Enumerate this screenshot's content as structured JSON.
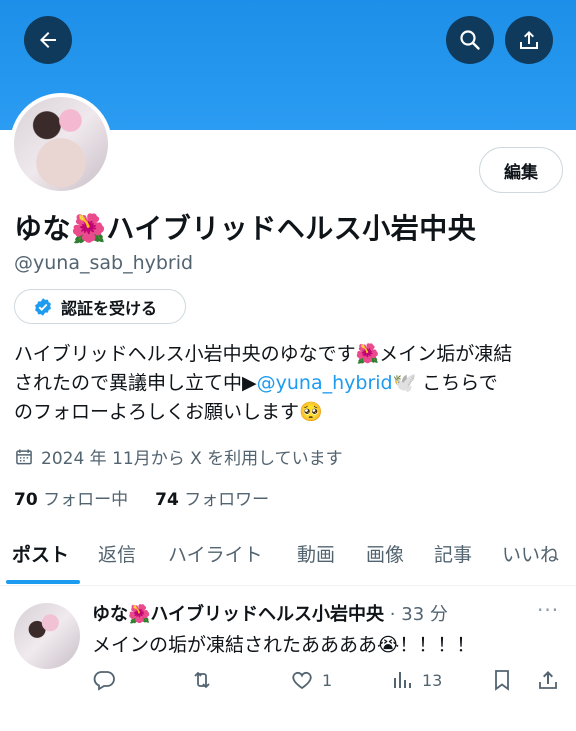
{
  "profile": {
    "display_name": "ゆな🌺ハイブリッドヘルス小岩中央",
    "handle": "@yuna_sab_hybrid",
    "edit_label": "編集",
    "verify_label": "認証を受ける",
    "bio": {
      "line1": "ハイブリッドヘルス小岩中央のゆなです🌺メイン垢が凍結",
      "line2_pre": "されたので異議申し立て中▶",
      "line2_mention": "@yuna_hybrid",
      "line2_post": "🕊️ こちらで",
      "line3": "のフォローよろしくお願いします🥺"
    },
    "joined": "2024 年 11月から X を利用しています",
    "following_count": "70",
    "following_label": "フォロー中",
    "followers_count": "74",
    "followers_label": "フォロワー"
  },
  "tabs": [
    "ポスト",
    "返信",
    "ハイライト",
    "動画",
    "画像",
    "記事",
    "いいね"
  ],
  "active_tab": "ポスト",
  "tweet": {
    "name": "ゆな🌺ハイブリッドヘルス小岩中央",
    "time": "· 33 分",
    "more": "···",
    "text": "メインの垢が凍結されたああああ😭！！！！",
    "likes": "1",
    "views": "13"
  },
  "colors": {
    "banner": "#1d8fe8",
    "accent": "#1d9bf0",
    "muted": "#536471"
  },
  "icons": [
    "back-arrow-icon",
    "search-icon",
    "share-icon",
    "verified-badge-icon",
    "calendar-icon",
    "reply-icon",
    "retweet-icon",
    "heart-icon",
    "views-icon",
    "bookmark-icon"
  ]
}
